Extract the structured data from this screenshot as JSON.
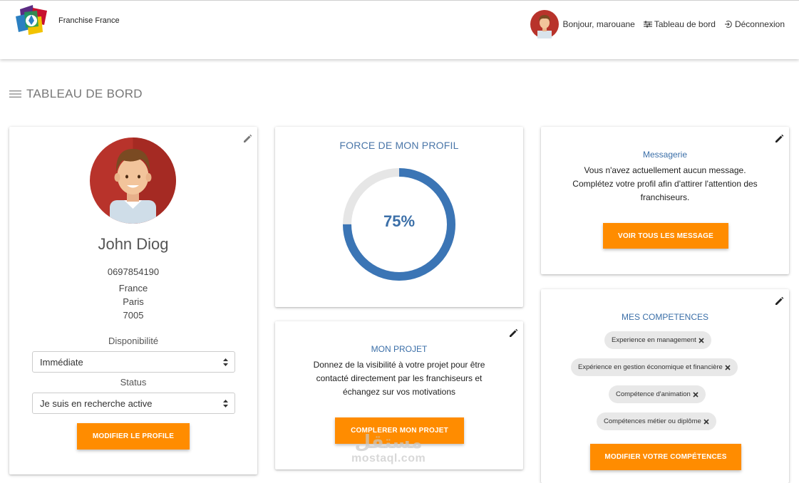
{
  "header": {
    "brand_name": "Franchise France",
    "greeting": "Bonjour, marouane",
    "dashboard_link": "Tableau de bord",
    "logout_link": "Déconnexion"
  },
  "page": {
    "title": "TABLEAU DE BORD"
  },
  "profile": {
    "name": "John Diog",
    "phone": "0697854190",
    "country": "France",
    "city": "Paris",
    "postal": "7005",
    "availability_label": "Disponibilité",
    "availability_value": "Immédiate",
    "status_label": "Status",
    "status_value": "Je suis en recherche active",
    "edit_button": "MODIFIER LE PROFILE"
  },
  "strength": {
    "title": "FORCE DE MON PROFIL",
    "value": 75,
    "label": "75%",
    "colors": {
      "filled": "#3b75b5",
      "track": "#e6e6e6"
    }
  },
  "project": {
    "title": "MON PROJET",
    "text_lines": [
      "Donnez de la visibilité à votre projet pour être",
      "contacté directement par les franchiseurs et",
      "échangez sur vos motivations"
    ],
    "button": "COMPLERER MON PROJET"
  },
  "messages": {
    "title": "Messagerie",
    "text_lines": [
      "Vous n'avez actuellement aucun message.",
      "Complétez votre profil afin d'attirer l'attention des",
      "franchiseurs."
    ],
    "button": "VOIR TOUS LES MESSAGE"
  },
  "skills": {
    "title": "MES COMPETENCES",
    "items": [
      "Experience en management",
      "Expérience en gestion économique et financière",
      "Compétence d'animation",
      "Compétences métier ou diplôme"
    ],
    "button": "MODIFIER VOTRE COMPÉTENCES"
  },
  "watermark": {
    "arabic": "مستقل",
    "latin": "mostaql.com"
  },
  "colors": {
    "accent": "#ff8c00",
    "title_blue": "#3b6fa8"
  }
}
